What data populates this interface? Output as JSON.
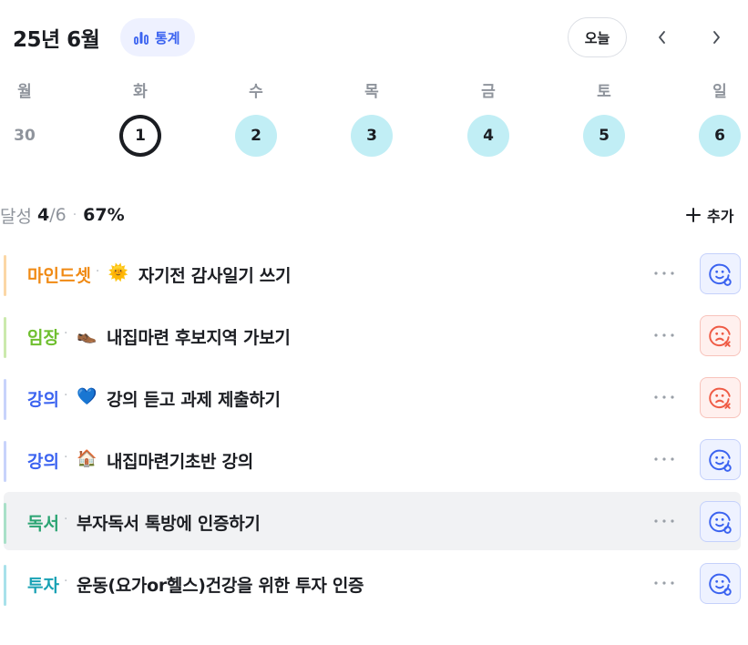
{
  "header": {
    "month_title": "25년 6월",
    "stats_label": "통계",
    "today_label": "오늘",
    "prev_icon": "chevron-left-icon",
    "next_icon": "chevron-right-icon"
  },
  "week": {
    "days": [
      {
        "weekday": "월",
        "date": "30",
        "state": "plain"
      },
      {
        "weekday": "화",
        "date": "1",
        "state": "selected"
      },
      {
        "weekday": "수",
        "date": "2",
        "state": "done"
      },
      {
        "weekday": "목",
        "date": "3",
        "state": "done"
      },
      {
        "weekday": "금",
        "date": "4",
        "state": "done"
      },
      {
        "weekday": "토",
        "date": "5",
        "state": "done"
      },
      {
        "weekday": "일",
        "date": "6",
        "state": "done"
      }
    ]
  },
  "summary": {
    "label": "달성",
    "done": "4",
    "slash": "/",
    "total": "6",
    "percent": "67%",
    "add_label": "추가"
  },
  "tasks": [
    {
      "category": "마인드셋",
      "category_color": "#f08a14",
      "bar_color": "#fbd7a6",
      "emoji": "🌞",
      "title": "자기전 감사일기 쓰기",
      "status": "ok",
      "highlight": false
    },
    {
      "category": "임장",
      "category_color": "#6fbf2f",
      "bar_color": "#cbe9ad",
      "emoji": "👞",
      "title": "내집마련 후보지역 가보기",
      "status": "fail",
      "highlight": false
    },
    {
      "category": "강의",
      "category_color": "#3b63f0",
      "bar_color": "#c8d3fb",
      "emoji": "💙",
      "title": "강의 듣고 과제 제출하기",
      "status": "fail",
      "highlight": false
    },
    {
      "category": "강의",
      "category_color": "#3b63f0",
      "bar_color": "#c8d3fb",
      "emoji": "🏠",
      "title": "내집마련기초반 강의",
      "status": "ok",
      "highlight": false
    },
    {
      "category": "독서",
      "category_color": "#2aa472",
      "bar_color": "#a9e0c8",
      "emoji": "",
      "title": "부자독서 톡방에 인증하기",
      "status": "ok",
      "highlight": true
    },
    {
      "category": "투자",
      "category_color": "#1aa2b5",
      "bar_color": "#a8e1ea",
      "emoji": "",
      "title": "운동(요가or헬스)건강을 위한 투자 인증",
      "status": "ok",
      "highlight": false
    }
  ],
  "colors": {
    "accent": "#3b63f0",
    "done_circle": "#c1eef5",
    "ok_icon": "#3b63f0",
    "fail_icon": "#ef5b45"
  }
}
